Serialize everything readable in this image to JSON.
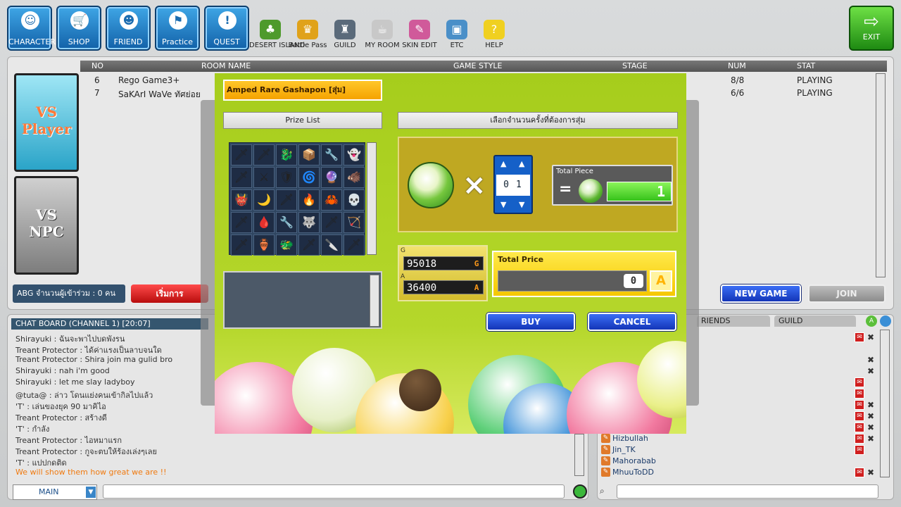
{
  "topbar": {
    "buttons": [
      {
        "label": "CHARACTER",
        "icon": "character-icon"
      },
      {
        "label": "SHOP",
        "icon": "cart-icon"
      },
      {
        "label": "FRIEND",
        "icon": "friend-icon"
      },
      {
        "label": "Practice",
        "icon": "practice-icon"
      },
      {
        "label": "QUEST",
        "icon": "quest-icon"
      }
    ],
    "menu": [
      {
        "label": "DESERT ISLAND",
        "icon": "palm-tree-icon"
      },
      {
        "label": "Battle Pass",
        "icon": "trophy-icon"
      },
      {
        "label": "GUILD",
        "icon": "castle-icon"
      },
      {
        "label": "MY ROOM",
        "icon": "mug-icon"
      },
      {
        "label": "SKIN EDIT",
        "icon": "spray-can-icon"
      },
      {
        "label": "ETC",
        "icon": "box-icon"
      },
      {
        "label": "HELP",
        "icon": "question-icon"
      }
    ],
    "exit_label": "EXIT"
  },
  "room_list": {
    "headers": {
      "no": "NO",
      "room_name": "ROOM NAME",
      "game_style": "GAME STYLE",
      "stage": "STAGE",
      "num": "NUM",
      "stat": "STAT"
    },
    "rows": [
      {
        "no": "6",
        "name": "Rego Game3+",
        "num": "8/8",
        "stat": "PLAYING"
      },
      {
        "no": "7",
        "name": "SaKArI WaVe ทัศย่อย",
        "num": "6/6",
        "stat": "PLAYING"
      }
    ],
    "vs_player": "VS Player",
    "vs_npc": "VS NPC",
    "abg_text": "ABG จำนวนผู้เข้าร่วม : 0 คน",
    "start_label": "เริ่มการ",
    "new_game": "NEW GAME",
    "join": "JOIN"
  },
  "chat": {
    "header": "CHAT BOARD (CHANNEL 1) [20:07]",
    "lines": [
      {
        "text": "Shirayuki : ฉันจะพาไปบดพังรน",
        "orange": false
      },
      {
        "text": "Treant Protector : ได้ค่าแรงเป็นลาบจนใด",
        "orange": false
      },
      {
        "text": "Treant Protector : Shira join ma gulid bro",
        "orange": false
      },
      {
        "text": "Shirayuki : nah i'm good",
        "orange": false
      },
      {
        "text": "Shirayuki : let me slay ladyboy",
        "orange": false
      },
      {
        "text": "@tuta@ : ล่าว โดนแย่งคนเข้ากิลไปแล้ว",
        "orange": false
      },
      {
        "text": "'T' : เล่นของยุค 90 มาคิไอ",
        "orange": false
      },
      {
        "text": "Treant Protector : สร้างดี",
        "orange": false
      },
      {
        "text": "'T' : กำลัง",
        "orange": false
      },
      {
        "text": "Treant Protector : ไอหมาแรก",
        "orange": false
      },
      {
        "text": "Treant Protector : กูจะตบให้ร้องเล่งๆเลย",
        "orange": false
      },
      {
        "text": "'T' : แปปกดติด",
        "orange": false
      },
      {
        "text": "We will show them how great we are !!",
        "orange": true
      }
    ],
    "channel": "MAIN"
  },
  "friends": {
    "tab_friends": "RIENDS",
    "tab_guild": "GUILD",
    "names": [
      "Hizbullah",
      "Jin_TK",
      "Mahorabab",
      "MhuuToDD"
    ]
  },
  "gashapon": {
    "title": "Amped Rare Gashapon [สุ่ม]",
    "prize_list_label": "Prize List",
    "select_label": "เลือกจำนวนครั้งที่ต้องการสุ่ม",
    "prizes": [
      "🗡",
      "🗡",
      "🐉",
      "📦",
      "🔧",
      "👻",
      "🗡",
      "⚔",
      "🛡",
      "🌀",
      "🔮",
      "🐗",
      "👹",
      "🌙",
      "🗡",
      "🔥",
      "🦀",
      "💀",
      "🗡",
      "🩸",
      "🔧",
      "🐺",
      "🗡",
      "🏹",
      "🗡",
      "🏺",
      "🐲",
      "🗡",
      "🔪",
      "🗡"
    ],
    "counter_digits": "01",
    "total_piece_label": "Total Piece",
    "total_piece_value": "1",
    "gold_label": "G",
    "gold_value": "95018",
    "gold_currency": "G",
    "amp_label": "A",
    "amp_value": "36400",
    "amp_currency": "A",
    "total_price_label": "Total Price",
    "total_price_value": "0",
    "price_currency": "A",
    "buy": "BUY",
    "cancel": "CANCEL"
  },
  "colors": {
    "dialog_green": "#a6cd1c",
    "title_orange": "#f5a300",
    "button_blue": "#1335b8",
    "exit_green": "#1e8a12"
  }
}
